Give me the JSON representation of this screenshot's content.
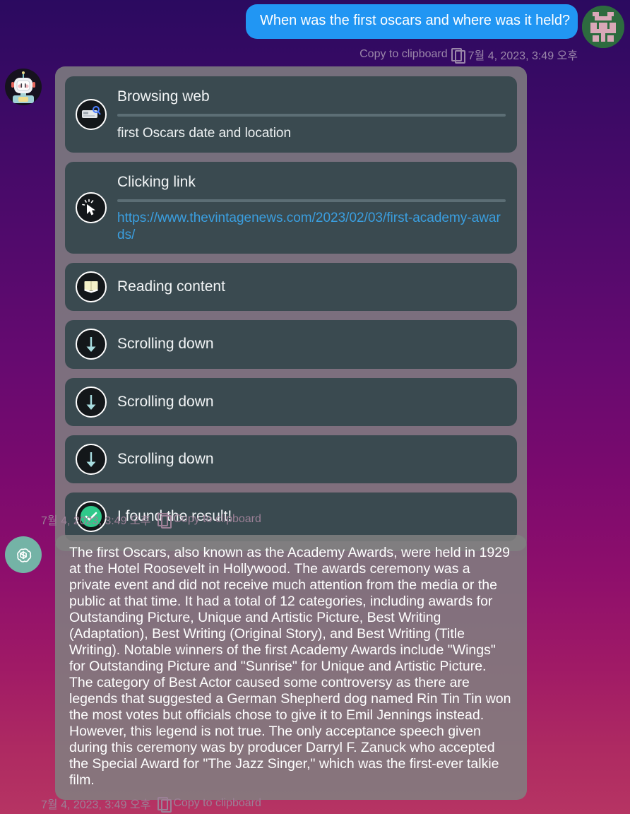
{
  "theme": {
    "bg_gradient_top": "#2b0a60",
    "bg_gradient_bottom": "#b63463",
    "user_bubble_color": "#2196f3",
    "card_bg": "#3a4a50",
    "block_bg": "#808080",
    "link_color": "#3a9fe0",
    "success_color": "#2fc98a"
  },
  "user_message": {
    "text": "When was the first oscars and where was it held?",
    "copy_label": "Copy to clipboard",
    "timestamp": "7월 4, 2023, 3:49 오후",
    "avatar_name": "robot-pixel-avatar"
  },
  "browsing": {
    "avatar_name": "assistant-robot-avatar",
    "steps": [
      {
        "title": "Browsing web",
        "subtitle": "first Oscars date and location",
        "icon": "web-search-icon",
        "has_divider": true,
        "link": null
      },
      {
        "title": "Clicking link",
        "subtitle": null,
        "icon": "click-cursor-icon",
        "has_divider": true,
        "link": "https://www.thevintagenews.com/2023/02/03/first-academy-awards/"
      },
      {
        "title": "Reading content",
        "subtitle": null,
        "icon": "reading-book-icon",
        "has_divider": false,
        "link": null
      },
      {
        "title": "Scrolling down",
        "subtitle": null,
        "icon": "scroll-down-arrow-icon",
        "has_divider": false,
        "link": null
      },
      {
        "title": "Scrolling down",
        "subtitle": null,
        "icon": "scroll-down-arrow-icon",
        "has_divider": false,
        "link": null
      },
      {
        "title": "Scrolling down",
        "subtitle": null,
        "icon": "scroll-down-arrow-icon",
        "has_divider": false,
        "link": null
      },
      {
        "title": "I found the result!",
        "subtitle": null,
        "icon": "success-check-icon",
        "has_divider": false,
        "link": null
      }
    ],
    "meta": {
      "timestamp": "7월 4, 2023, 3:49 오후",
      "copy_label": "Copy to clipboard"
    }
  },
  "assistant_response": {
    "avatar_name": "openai-logo-avatar",
    "text": "The first Oscars, also known as the Academy Awards, were held in 1929 at the Hotel Roosevelt in Hollywood. The awards ceremony was a private event and did not receive much attention from the media or the public at that time. It had a total of 12 categories, including awards for Outstanding Picture, Unique and Artistic Picture, Best Writing (Adaptation), Best Writing (Original Story), and Best Writing (Title Writing). Notable winners of the first Academy Awards include \"Wings\" for Outstanding Picture and \"Sunrise\" for Unique and Artistic Picture. The category of Best Actor caused some controversy as there are legends that suggested a German Shepherd dog named Rin Tin Tin won the most votes but officials chose to give it to Emil Jennings instead. However, this legend is not true. The only acceptance speech given during this ceremony was by producer Darryl F. Zanuck who accepted the Special Award for \"The Jazz Singer,\" which was the first-ever talkie film.",
    "meta": {
      "timestamp": "7월 4, 2023, 3:49 오후",
      "copy_label": "Copy to clipboard"
    }
  }
}
